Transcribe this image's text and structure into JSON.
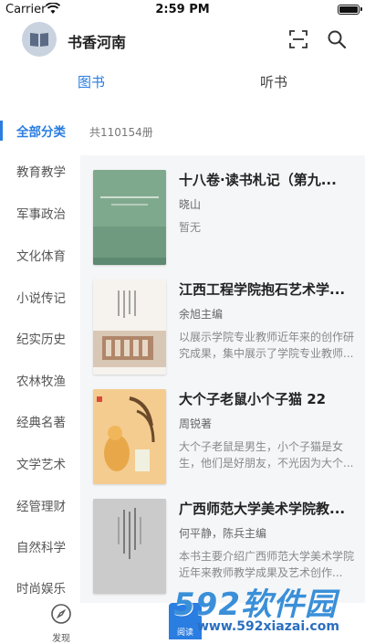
{
  "status_bar": {
    "carrier": "Carrier",
    "time": "2:59 PM"
  },
  "header": {
    "library_name": "书香河南"
  },
  "tabs": [
    {
      "label": "图书",
      "active": true
    },
    {
      "label": "听书",
      "active": false
    }
  ],
  "sidebar": {
    "items": [
      {
        "label": "全部分类",
        "active": true
      },
      {
        "label": "教育教学"
      },
      {
        "label": "军事政治"
      },
      {
        "label": "文化体育"
      },
      {
        "label": "小说传记"
      },
      {
        "label": "纪实历史"
      },
      {
        "label": "农林牧渔"
      },
      {
        "label": "经典名著"
      },
      {
        "label": "文学艺术"
      },
      {
        "label": "经管理财"
      },
      {
        "label": "自然科学"
      },
      {
        "label": "时尚娱乐"
      }
    ]
  },
  "content": {
    "count": "共110154册",
    "books": [
      {
        "title": "十八卷·读书札记（第九...",
        "author": "晓山",
        "desc": "暂无",
        "cover_color": "#7aa68a"
      },
      {
        "title": "江西工程学院抱石艺术学...",
        "author": "余旭主编",
        "desc": "以展示学院专业教师近年来的创作研究成果，集中展示了学院专业教师...",
        "cover_color": "#f4f1ec"
      },
      {
        "title": "大个子老鼠小个子猫 22",
        "author": "周锐著",
        "desc": "大个子老鼠是男生，小个子猫是女生，他们是好朋友，不光因为大个...",
        "cover_color": "#f3c88a"
      },
      {
        "title": "广西师范大学美术学院教...",
        "author": "何平静，陈兵主编",
        "desc": "本书主要介绍广西师范大学美术学院近年来教师教学成果及艺术创作...",
        "cover_color": "#c9c9c9"
      }
    ]
  },
  "bottom_nav": {
    "discover": "发现",
    "read": "阅读"
  },
  "watermark": {
    "brand": "592软件园",
    "url": "www.592xiazai.com"
  },
  "colors": {
    "accent": "#2a7de1",
    "list_bg": "#f5f6f8"
  }
}
